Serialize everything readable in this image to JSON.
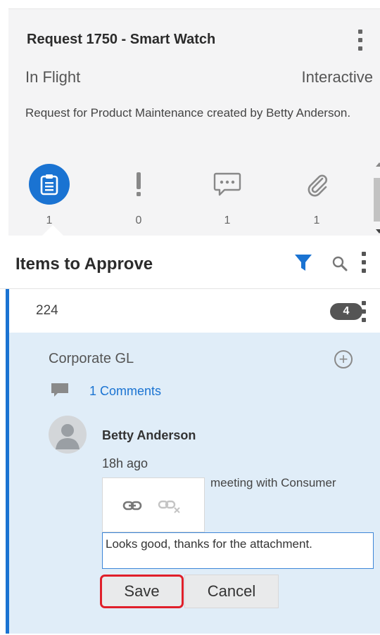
{
  "request": {
    "title": "Request 1750 - Smart Watch",
    "status": "In Flight",
    "mode": "Interactive",
    "description": "Request for Product Maintenance created by Betty Anderson."
  },
  "stats": {
    "approvals": {
      "icon": "clipboard-icon",
      "count": "1"
    },
    "issues": {
      "icon": "exclamation-icon",
      "count": "0"
    },
    "comments": {
      "icon": "chat-bubble-icon",
      "count": "1"
    },
    "attachments": {
      "icon": "paperclip-icon",
      "count": "1"
    }
  },
  "section": {
    "title": "Items to Approve"
  },
  "item": {
    "id": "224",
    "badge": "4",
    "gl_label": "Corporate GL",
    "comments_link": "1 Comments"
  },
  "comment": {
    "author": "Betty Anderson",
    "time": "18h ago",
    "attachment_text": "meeting with Consumer",
    "input_value": "Looks good, thanks for the attachment."
  },
  "buttons": {
    "save": "Save",
    "cancel": "Cancel"
  },
  "colors": {
    "accent": "#1a73d2",
    "detail_bg": "#e0edf8",
    "highlight": "#e0202a"
  }
}
